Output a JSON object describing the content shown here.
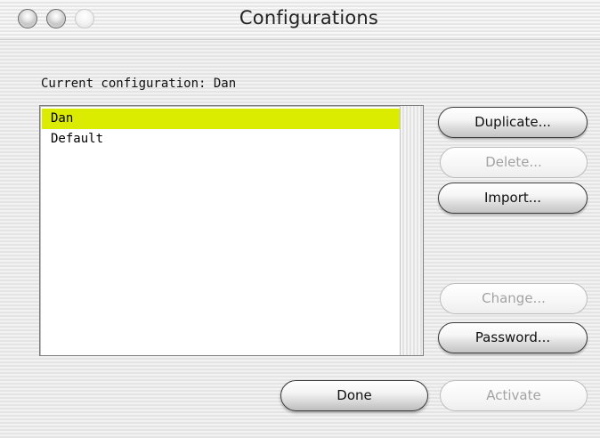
{
  "window": {
    "title": "Configurations"
  },
  "current_configuration_text": "Current configuration: Dan",
  "configurations": {
    "items": [
      "Dan",
      "Default"
    ],
    "selected": "Dan",
    "selection_color": "#dcec00"
  },
  "buttons": {
    "duplicate": {
      "label": "Duplicate...",
      "enabled": true
    },
    "delete": {
      "label": "Delete...",
      "enabled": false
    },
    "import": {
      "label": "Import...",
      "enabled": true
    },
    "change": {
      "label": "Change...",
      "enabled": false
    },
    "password": {
      "label": "Password...",
      "enabled": true
    },
    "done": {
      "label": "Done",
      "enabled": true
    },
    "activate": {
      "label": "Activate",
      "enabled": false
    }
  }
}
